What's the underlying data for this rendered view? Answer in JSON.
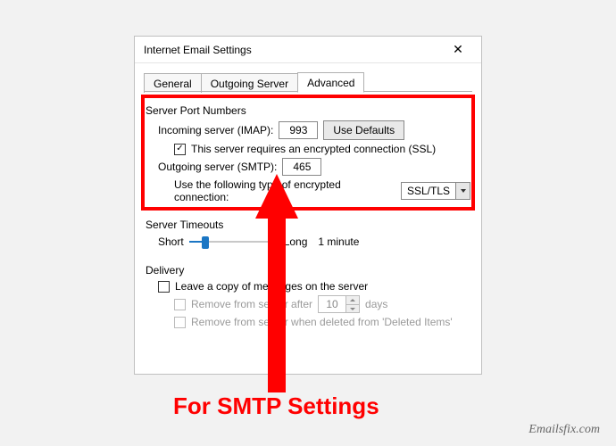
{
  "dialog": {
    "title": "Internet Email Settings"
  },
  "tabs": {
    "general": "General",
    "outgoing": "Outgoing Server",
    "advanced": "Advanced"
  },
  "server_ports": {
    "group_title": "Server Port Numbers",
    "incoming_label": "Incoming server (IMAP):",
    "incoming_value": "993",
    "use_defaults": "Use Defaults",
    "ssl_required_label": "This server requires an encrypted connection (SSL)",
    "ssl_required_checked": true,
    "outgoing_label": "Outgoing server (SMTP):",
    "outgoing_value": "465",
    "enc_type_label": "Use the following type of encrypted connection:",
    "enc_type_value": "SSL/TLS"
  },
  "timeouts": {
    "group_title": "Server Timeouts",
    "short": "Short",
    "long": "Long",
    "value": "1 minute"
  },
  "delivery": {
    "group_title": "Delivery",
    "leave_copy": "Leave a copy of messages on the server",
    "remove_after_prefix": "Remove from server after",
    "remove_after_days": "10",
    "remove_after_suffix": "days",
    "remove_deleted": "Remove from server when deleted from 'Deleted Items'"
  },
  "annotation": {
    "caption": "For SMTP Settings"
  },
  "watermark": "Emailsfix.com"
}
